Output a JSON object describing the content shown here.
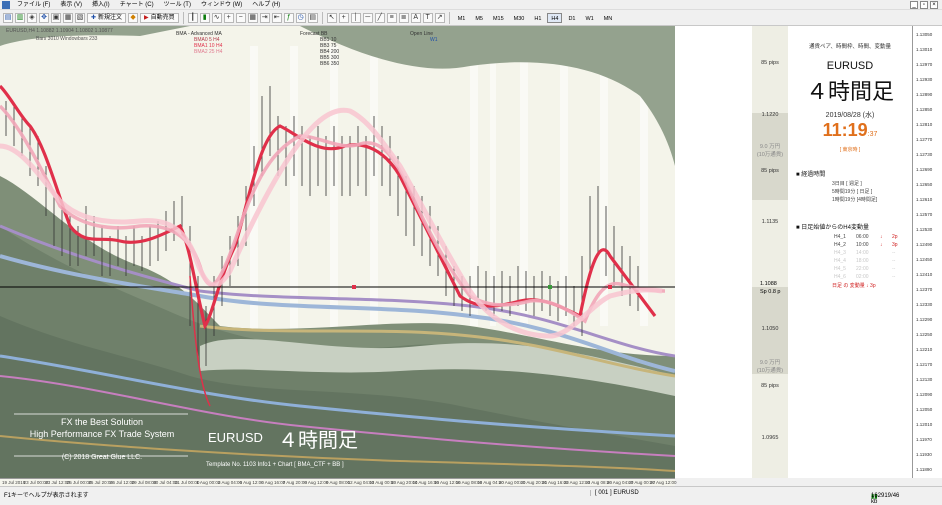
{
  "menu": [
    "ファイル (F)",
    "表示 (V)",
    "挿入(I)",
    "チャート (C)",
    "ツール (T)",
    "ウィンドウ (W)",
    "ヘルプ (H)"
  ],
  "toolbar": {
    "new_order": "新規注文",
    "auto_trade": "自動売買",
    "timeframes": [
      "M1",
      "M5",
      "M15",
      "M30",
      "H1",
      "H4",
      "D1",
      "W1",
      "MN"
    ],
    "active_timeframe": "H4"
  },
  "chart": {
    "header_line1": "EURUSD,H4  1.10882 1.10904 1.10802 1.10877",
    "header_line2": "Bars 3010   Windowbars 233",
    "legend": {
      "bma_title": "BMA - Advanced MA",
      "bma_items": [
        "BMA0  5   H4",
        "BMA1  10  H4",
        "BMA2  25  H4"
      ],
      "forecast_title": "Forecast BB",
      "forecast_items": [
        "BB1 10",
        "BB3 75",
        "BB4 200",
        "BB5 300",
        "BB6 350"
      ],
      "openline_title": "Open Line",
      "openline_items": [
        "W1"
      ]
    },
    "logo": {
      "line1": "FX the Best Solution",
      "line2": "High Performance FX Trade System",
      "copyright": "(C)  2018   Great Glue LLC."
    },
    "footer_symbol": "EURUSD",
    "footer_tf": "４時間足",
    "footer_info": "Template   No. 1103          Info1   +   Chart   [ BMA_CTF + BB ]",
    "price_line_label": "1.1088",
    "spread_label": "Sp  0.8 p",
    "level_labels": [
      "1.1220",
      "1.1135",
      "1.1050",
      "1.0965"
    ],
    "pips_labels": [
      {
        "text": "85 pips"
      },
      {
        "text": "9.0 万円\n(10万通貨)"
      },
      {
        "text": "85 pips"
      },
      {
        "text": "9.0 万円\n(10万通貨)"
      },
      {
        "text": "85 pips"
      }
    ],
    "x_labels": [
      "19 Jul 2019",
      "23 Jul 00:00",
      "23 Jul 12:00",
      "25 Jul 00:00",
      "25 Jul 20:00",
      "26 Jul 12:00",
      "29 Jul 08:00",
      "30 Jul 04:00",
      "31 Jul 00:00",
      "1 Aug 00:00",
      "2 Aug 04:00",
      "5 Aug 12:00",
      "6 Aug 16:00",
      "7 Aug 20:00",
      "8 Aug 12:00",
      "9 Aug 08:00",
      "12 Aug 04:00",
      "13 Aug 00:00",
      "13 Aug 20:00",
      "14 Aug 16:00",
      "15 Aug 12:00",
      "16 Aug 08:00",
      "19 Aug 04:00",
      "20 Aug 00:00",
      "20 Aug 20:00",
      "21 Aug 16:00",
      "22 Aug 12:00",
      "23 Aug 08:00",
      "26 Aug 04:00",
      "27 Aug 00:00",
      "27 Aug 12:00"
    ]
  },
  "info_panel": {
    "subtitle": "通貨ペア、時間枠、時間、変動量",
    "symbol": "EURUSD",
    "timeframe": "４時間足",
    "date": "2019/08/28 (水)",
    "clock": "11:19",
    "seconds": ":37",
    "session": "[ 東京時 ]",
    "elapsed_title": "経過時間",
    "elapsed_rows": [
      "3日目  [  週足 ]",
      "5時間19分  [  日足 ]",
      "1時間19分  [4時間足]"
    ],
    "h4_title": "日足始値からのH4変動量",
    "h4_rows": [
      {
        "label": "H4_1",
        "time": "06:00",
        "arrow": "↓",
        "val": "2p",
        "active": true
      },
      {
        "label": "H4_2",
        "time": "10:00",
        "arrow": "↓",
        "val": "3p",
        "active": true
      },
      {
        "label": "H4_3",
        "time": "14:00",
        "arrow": "",
        "val": "--",
        "active": false
      },
      {
        "label": "H4_4",
        "time": "18:00",
        "arrow": "",
        "val": "--",
        "active": false
      },
      {
        "label": "H4_5",
        "time": "22:00",
        "arrow": "",
        "val": "--",
        "active": false
      },
      {
        "label": "H4_6",
        "time": "02:00",
        "arrow": "",
        "val": "--",
        "active": false
      }
    ],
    "daily_change": "日足 の 変動量   ↓   3p"
  },
  "price_axis": [
    "1.13050",
    "1.13010",
    "1.12970",
    "1.12930",
    "1.12890",
    "1.12850",
    "1.12810",
    "1.12770",
    "1.12730",
    "1.12690",
    "1.12650",
    "1.12610",
    "1.12570",
    "1.12530",
    "1.12490",
    "1.12450",
    "1.12410",
    "1.12370",
    "1.12330",
    "1.12290",
    "1.12250",
    "1.12210",
    "1.12170",
    "1.12130",
    "1.12090",
    "1.12050",
    "1.12010",
    "1.11970",
    "1.11930",
    "1.11890"
  ],
  "status": {
    "help": "F1キーでヘルプが表示されます",
    "profile": "[ 001 ]   EURUSD",
    "connection": "162919/46 kb"
  },
  "colors": {
    "bma0": "#b23a4a",
    "bma1": "#e0304a",
    "bma2": "#f2a6b8",
    "clock": "#e0701c",
    "band_dark": "#7a8a73",
    "band_mid": "#aab8a3"
  }
}
